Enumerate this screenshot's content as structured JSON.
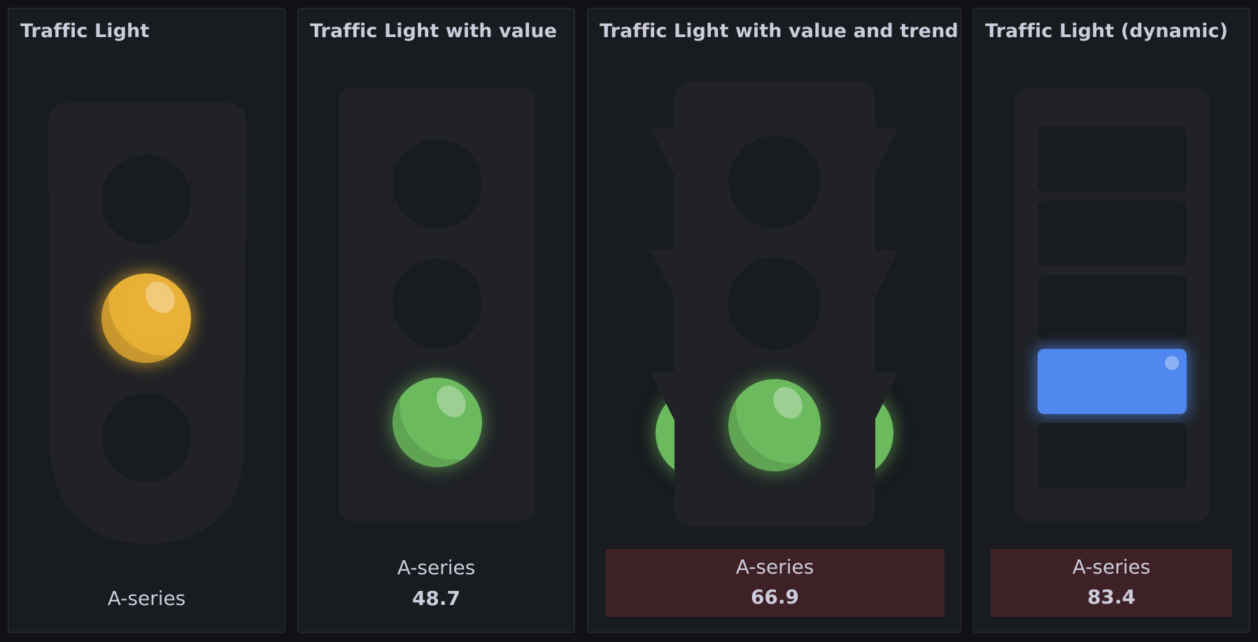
{
  "panels": [
    {
      "title": "Traffic Light",
      "series": "A-series",
      "state": "yellow",
      "value": ""
    },
    {
      "title": "Traffic Light with value",
      "series": "A-series",
      "state": "green",
      "value": "48.7"
    },
    {
      "title": "Traffic Light with value and trend",
      "series": "A-series",
      "state": "green",
      "value": "66.9"
    },
    {
      "title": "Traffic Light (dynamic)",
      "series": "A-series",
      "state": "blue",
      "value": "83.4"
    }
  ],
  "colors": {
    "background": "#111217",
    "panel": "#181b1f",
    "light_body": "#202226",
    "yellow": "#e7b035",
    "green": "#6cba5e",
    "blue": "#5088f0",
    "value_box": "#3e2126",
    "text": "#ccccdc"
  },
  "dynamic_light": {
    "slot_count": 5,
    "active_slot": 4
  }
}
